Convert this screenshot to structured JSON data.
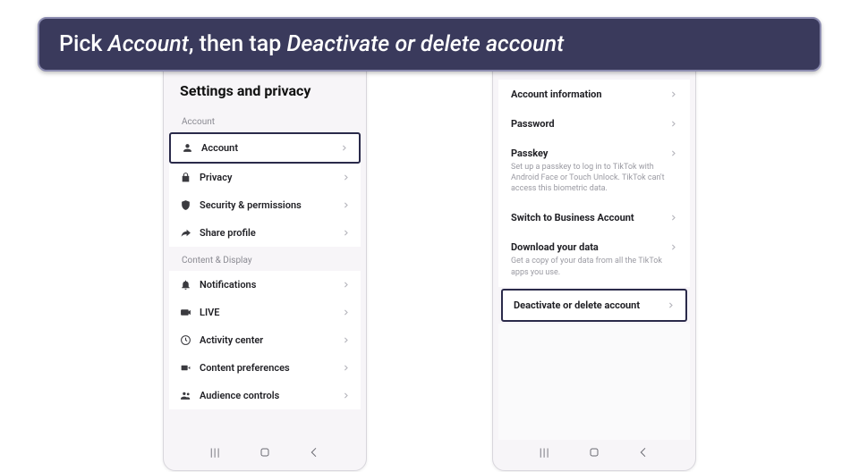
{
  "instruction": {
    "prefix": "Pick ",
    "em1": "Account",
    "mid": ", then tap ",
    "em2": "Deactivate or delete account"
  },
  "left": {
    "title": "Settings and privacy",
    "section1": "Account",
    "items1": [
      {
        "label": "Account",
        "icon": "person-icon",
        "outlined": true
      },
      {
        "label": "Privacy",
        "icon": "lock-icon"
      },
      {
        "label": "Security & permissions",
        "icon": "shield-icon"
      },
      {
        "label": "Share profile",
        "icon": "share-icon"
      }
    ],
    "section2": "Content & Display",
    "items2": [
      {
        "label": "Notifications",
        "icon": "bell-icon"
      },
      {
        "label": "LIVE",
        "icon": "live-icon"
      },
      {
        "label": "Activity center",
        "icon": "clock-icon"
      },
      {
        "label": "Content preferences",
        "icon": "video-icon"
      },
      {
        "label": "Audience controls",
        "icon": "people-icon"
      }
    ]
  },
  "right": {
    "rows": [
      {
        "title": "Account information"
      },
      {
        "title": "Password"
      },
      {
        "title": "Passkey",
        "sub": "Set up a passkey to log in to TikTok with Android Face or Touch Unlock. TikTok can't access this biometric data."
      },
      {
        "title": "Switch to Business Account"
      },
      {
        "title": "Download your data",
        "sub": "Get a copy of your data from all the TikTok apps you use."
      },
      {
        "title": "Deactivate or delete account",
        "outlined": true
      }
    ]
  }
}
